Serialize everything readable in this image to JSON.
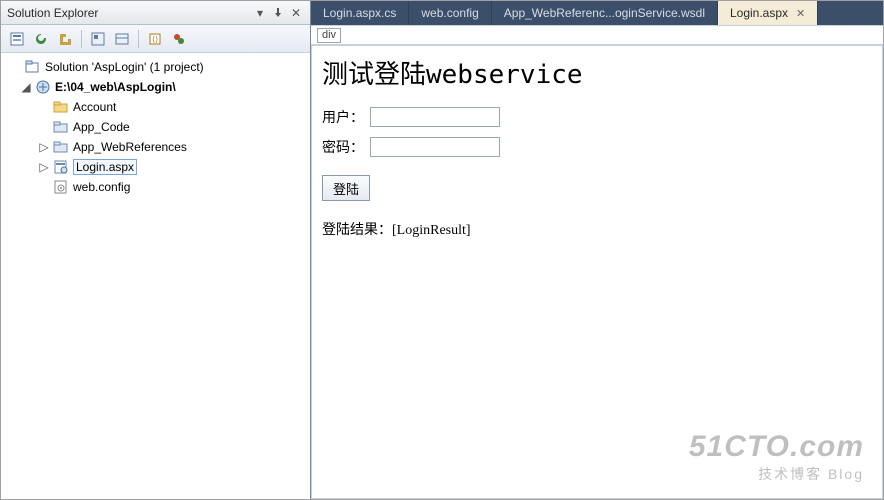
{
  "panel": {
    "title": "Solution Explorer",
    "toolbar_icons": [
      "properties",
      "refresh",
      "nest",
      "show-all",
      "sync",
      "view-code",
      "view-designer"
    ]
  },
  "tree": {
    "solution": "Solution 'AspLogin' (1 project)",
    "project": "E:\\04_web\\AspLogin\\",
    "nodes": [
      {
        "name": "Account",
        "icon": "folder",
        "indent": 2,
        "expander": "none"
      },
      {
        "name": "App_Code",
        "icon": "folder-ref",
        "indent": 2,
        "expander": "none"
      },
      {
        "name": "App_WebReferences",
        "icon": "folder-ref",
        "indent": 2,
        "expander": "closed"
      },
      {
        "name": "Login.aspx",
        "icon": "aspx",
        "indent": 2,
        "expander": "closed",
        "selected": true
      },
      {
        "name": "web.config",
        "icon": "config",
        "indent": 2,
        "expander": "none"
      }
    ]
  },
  "tabs": [
    {
      "label": "Login.aspx.cs",
      "active": false
    },
    {
      "label": "web.config",
      "active": false
    },
    {
      "label": "App_WebReferenc...oginService.wsdl",
      "active": false
    },
    {
      "label": "Login.aspx",
      "active": true
    }
  ],
  "breadcrumb": "div",
  "form": {
    "heading": "测试登陆webservice",
    "user_label": "用户：",
    "user_value": "",
    "pwd_label": "密码：",
    "pwd_value": "",
    "submit_label": "登陆",
    "result_prefix": "登陆结果：",
    "result_placeholder": "[LoginResult]"
  },
  "watermark": {
    "big": "51CTO.com",
    "small": "技术博客  Blog"
  }
}
